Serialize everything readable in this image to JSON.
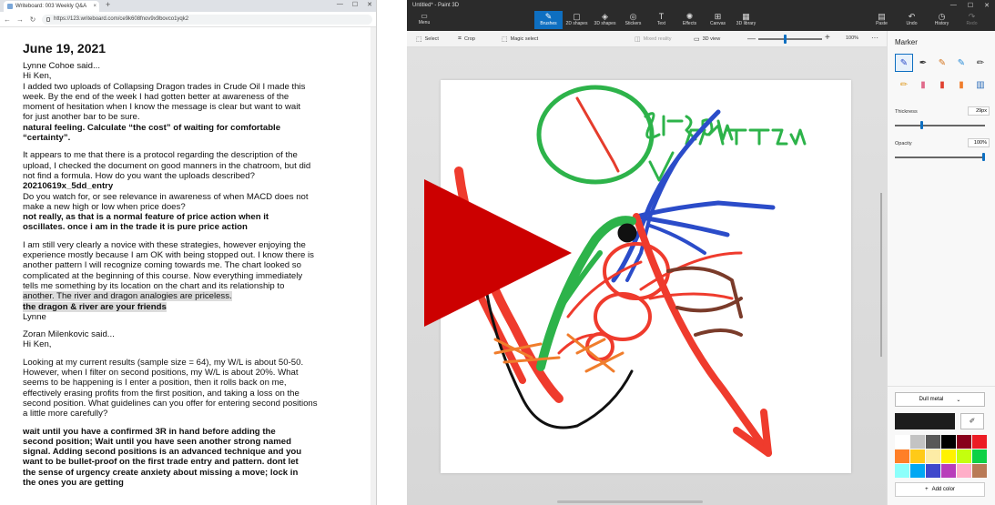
{
  "browser": {
    "tab_title": "Writeboard: 003 Weekly Q&A",
    "tab_close": "×",
    "new_tab": "+",
    "minimize": "—",
    "maximize": "☐",
    "close": "✕",
    "url": "https://123.writeboard.com/ce9k608fnov9x9bovco1yqk2"
  },
  "doc": {
    "date": "June 19, 2021",
    "q1_author": "Lynne Cohoe said...\nHi Ken,",
    "q1_text": "I added two uploads of Collapsing Dragon trades in Crude Oil I made this\nweek. By the end of the week I had gotten better at awareness of the\nmoment of hesitation when I know the message is clear but want to wait\nfor just another bar to be sure.",
    "a1": "natural feeling. Calculate “the cost” of waiting for comfortable\n“certainty”.",
    "q2_text": "It appears to me that there is a protocol regarding the description of the\nupload, I checked the document on good manners in the chatroom, but did\nnot find a formula. How do you want the uploads described?",
    "a2": "20210619x_5dd_entry",
    "q3_text": "Do you watch for, or see relevance in awareness of when MACD does not\nmake a new high or low when price does?",
    "a3": "not really, as that is a normal feature of price action when it\noscillates. once i am in the trade it is pure price action",
    "q4_text_a": "I am still very clearly a novice with these strategies, however enjoying the\nexperience mostly because I am OK with being stopped out. I know there is\nanother pattern I will recognize coming towards me. The chart looked so\ncomplicated at the beginning of this course. Now everything immediately\ntells me something by its location on the chart and its relationship to",
    "q4_text_b": "another. The river and dragon analogies are priceless.",
    "a4": "the dragon & river are your friends",
    "q4_sign": "Lynne",
    "q5_author": "Zoran Milenkovic said...\nHi Ken,",
    "q5_text": "Looking at my current results (sample size = 64), my W/L is about 50-50.\nHowever, when I filter on second positions, my W/L is about 20%. What\nseems to be happening is I enter a position, then it rolls back on me,\neffectively erasing profits from the first position, and taking a loss on the\nsecond position. What guidelines can you offer for entering second positions\na little more carefully?",
    "a5": "wait until you have a confirmed 3R in hand before adding the\nsecond position; Wait until you have seen another strong named\nsignal. Adding second positions is an advanced technique and you\nwant to be bullet-proof on the first trade entry and pattern. dont let\nthe sense of urgency create anxiety about missing a move; lock in\nthe ones you are getting"
  },
  "paint": {
    "title": "Untitled* - Paint 3D",
    "menu": "Menu",
    "tools": [
      {
        "label": "Brushes",
        "icon": "✎"
      },
      {
        "label": "2D shapes",
        "icon": "▢"
      },
      {
        "label": "3D shapes",
        "icon": "◈"
      },
      {
        "label": "Stickers",
        "icon": "◎"
      },
      {
        "label": "Text",
        "icon": "T"
      },
      {
        "label": "Effects",
        "icon": "✺"
      },
      {
        "label": "Canvas",
        "icon": "⊞"
      },
      {
        "label": "3D library",
        "icon": "▦"
      }
    ],
    "right_tools": [
      {
        "label": "Paste",
        "icon": "▤"
      },
      {
        "label": "Undo",
        "icon": "↶"
      },
      {
        "label": "History",
        "icon": "◷"
      },
      {
        "label": "Redo",
        "icon": "↷"
      }
    ],
    "subbar": {
      "select": "Select",
      "crop": "Crop",
      "magic_select": "Magic select",
      "mixed_reality": "Mixed reality",
      "view_3d": "3D view",
      "zoom": "100%",
      "zoom_level": 0.5
    },
    "panel": {
      "title": "Marker",
      "thickness_label": "Thickness",
      "thickness_value": "29px",
      "thickness_level": 0.29,
      "opacity_label": "Opacity",
      "opacity_value": "100%",
      "opacity_level": 1.0,
      "finish": "Dull metal",
      "add_color": "Add color",
      "swatches": [
        "#ffffff",
        "#c3c3c3",
        "#585858",
        "#000000",
        "#88001b",
        "#ec1c24",
        "#ff7f27",
        "#ffca18",
        "#fdeca6",
        "#fff200",
        "#c4ff0e",
        "#0ed145",
        "#8cfffb",
        "#00a8f3",
        "#3f48cc",
        "#b83dba",
        "#ffaec8",
        "#b97a56"
      ],
      "current_color": "#1c1c1c"
    }
  }
}
